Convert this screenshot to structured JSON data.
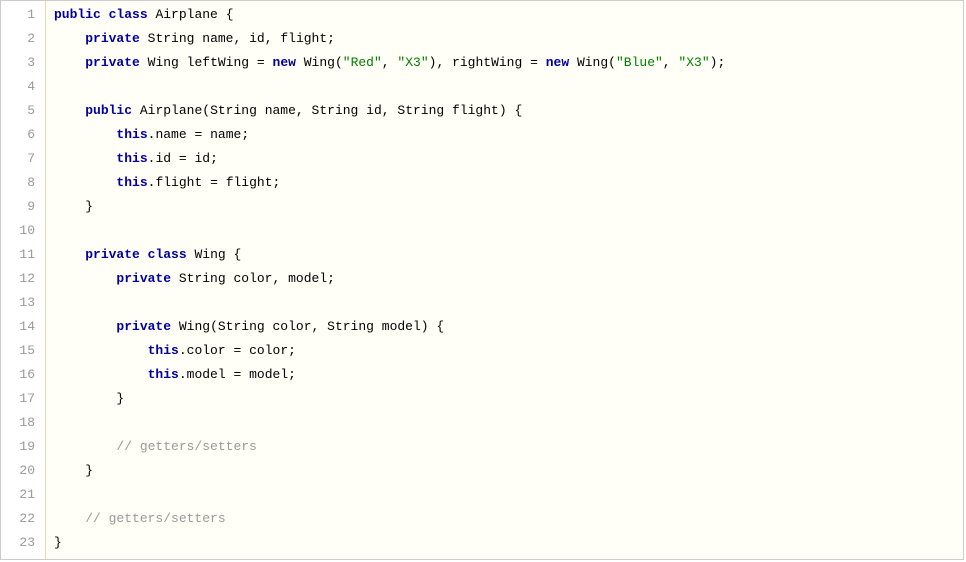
{
  "lines": [
    {
      "num": "1",
      "tokens": [
        {
          "t": "kw",
          "v": "public"
        },
        {
          "v": " "
        },
        {
          "t": "kw",
          "v": "class"
        },
        {
          "v": " "
        },
        {
          "t": "ident",
          "v": "Airplane"
        },
        {
          "v": " "
        },
        {
          "t": "punct",
          "v": "{"
        }
      ]
    },
    {
      "num": "2",
      "tokens": [
        {
          "v": "    "
        },
        {
          "t": "kw",
          "v": "private"
        },
        {
          "v": " "
        },
        {
          "t": "type",
          "v": "String"
        },
        {
          "v": " "
        },
        {
          "t": "ident",
          "v": "name"
        },
        {
          "t": "punct",
          "v": ","
        },
        {
          "v": " "
        },
        {
          "t": "ident",
          "v": "id"
        },
        {
          "t": "punct",
          "v": ","
        },
        {
          "v": " "
        },
        {
          "t": "ident",
          "v": "flight"
        },
        {
          "t": "punct",
          "v": ";"
        }
      ]
    },
    {
      "num": "3",
      "tokens": [
        {
          "v": "    "
        },
        {
          "t": "kw",
          "v": "private"
        },
        {
          "v": " "
        },
        {
          "t": "type",
          "v": "Wing"
        },
        {
          "v": " "
        },
        {
          "t": "ident",
          "v": "leftWing"
        },
        {
          "v": " "
        },
        {
          "t": "op",
          "v": "="
        },
        {
          "v": " "
        },
        {
          "t": "kw",
          "v": "new"
        },
        {
          "v": " "
        },
        {
          "t": "type",
          "v": "Wing"
        },
        {
          "t": "punct",
          "v": "("
        },
        {
          "t": "str",
          "v": "\"Red\""
        },
        {
          "t": "punct",
          "v": ","
        },
        {
          "v": " "
        },
        {
          "t": "str",
          "v": "\"X3\""
        },
        {
          "t": "punct",
          "v": ")"
        },
        {
          "t": "punct",
          "v": ","
        },
        {
          "v": " "
        },
        {
          "t": "ident",
          "v": "rightWing"
        },
        {
          "v": " "
        },
        {
          "t": "op",
          "v": "="
        },
        {
          "v": " "
        },
        {
          "t": "kw",
          "v": "new"
        },
        {
          "v": " "
        },
        {
          "t": "type",
          "v": "Wing"
        },
        {
          "t": "punct",
          "v": "("
        },
        {
          "t": "str",
          "v": "\"Blue\""
        },
        {
          "t": "punct",
          "v": ","
        },
        {
          "v": " "
        },
        {
          "t": "str",
          "v": "\"X3\""
        },
        {
          "t": "punct",
          "v": ")"
        },
        {
          "t": "punct",
          "v": ";"
        }
      ]
    },
    {
      "num": "4",
      "tokens": []
    },
    {
      "num": "5",
      "tokens": [
        {
          "v": "    "
        },
        {
          "t": "kw",
          "v": "public"
        },
        {
          "v": " "
        },
        {
          "t": "ident",
          "v": "Airplane"
        },
        {
          "t": "punct",
          "v": "("
        },
        {
          "t": "type",
          "v": "String"
        },
        {
          "v": " "
        },
        {
          "t": "ident",
          "v": "name"
        },
        {
          "t": "punct",
          "v": ","
        },
        {
          "v": " "
        },
        {
          "t": "type",
          "v": "String"
        },
        {
          "v": " "
        },
        {
          "t": "ident",
          "v": "id"
        },
        {
          "t": "punct",
          "v": ","
        },
        {
          "v": " "
        },
        {
          "t": "type",
          "v": "String"
        },
        {
          "v": " "
        },
        {
          "t": "ident",
          "v": "flight"
        },
        {
          "t": "punct",
          "v": ")"
        },
        {
          "v": " "
        },
        {
          "t": "punct",
          "v": "{"
        }
      ]
    },
    {
      "num": "6",
      "tokens": [
        {
          "v": "        "
        },
        {
          "t": "kw",
          "v": "this"
        },
        {
          "t": "punct",
          "v": "."
        },
        {
          "t": "ident",
          "v": "name"
        },
        {
          "v": " "
        },
        {
          "t": "op",
          "v": "="
        },
        {
          "v": " "
        },
        {
          "t": "ident",
          "v": "name"
        },
        {
          "t": "punct",
          "v": ";"
        }
      ]
    },
    {
      "num": "7",
      "tokens": [
        {
          "v": "        "
        },
        {
          "t": "kw",
          "v": "this"
        },
        {
          "t": "punct",
          "v": "."
        },
        {
          "t": "ident",
          "v": "id"
        },
        {
          "v": " "
        },
        {
          "t": "op",
          "v": "="
        },
        {
          "v": " "
        },
        {
          "t": "ident",
          "v": "id"
        },
        {
          "t": "punct",
          "v": ";"
        }
      ]
    },
    {
      "num": "8",
      "tokens": [
        {
          "v": "        "
        },
        {
          "t": "kw",
          "v": "this"
        },
        {
          "t": "punct",
          "v": "."
        },
        {
          "t": "ident",
          "v": "flight"
        },
        {
          "v": " "
        },
        {
          "t": "op",
          "v": "="
        },
        {
          "v": " "
        },
        {
          "t": "ident",
          "v": "flight"
        },
        {
          "t": "punct",
          "v": ";"
        }
      ]
    },
    {
      "num": "9",
      "tokens": [
        {
          "v": "    "
        },
        {
          "t": "punct",
          "v": "}"
        }
      ]
    },
    {
      "num": "10",
      "tokens": []
    },
    {
      "num": "11",
      "tokens": [
        {
          "v": "    "
        },
        {
          "t": "kw",
          "v": "private"
        },
        {
          "v": " "
        },
        {
          "t": "kw",
          "v": "class"
        },
        {
          "v": " "
        },
        {
          "t": "ident",
          "v": "Wing"
        },
        {
          "v": " "
        },
        {
          "t": "punct",
          "v": "{"
        }
      ]
    },
    {
      "num": "12",
      "tokens": [
        {
          "v": "        "
        },
        {
          "t": "kw",
          "v": "private"
        },
        {
          "v": " "
        },
        {
          "t": "type",
          "v": "String"
        },
        {
          "v": " "
        },
        {
          "t": "ident",
          "v": "color"
        },
        {
          "t": "punct",
          "v": ","
        },
        {
          "v": " "
        },
        {
          "t": "ident",
          "v": "model"
        },
        {
          "t": "punct",
          "v": ";"
        }
      ]
    },
    {
      "num": "13",
      "tokens": []
    },
    {
      "num": "14",
      "tokens": [
        {
          "v": "        "
        },
        {
          "t": "kw",
          "v": "private"
        },
        {
          "v": " "
        },
        {
          "t": "ident",
          "v": "Wing"
        },
        {
          "t": "punct",
          "v": "("
        },
        {
          "t": "type",
          "v": "String"
        },
        {
          "v": " "
        },
        {
          "t": "ident",
          "v": "color"
        },
        {
          "t": "punct",
          "v": ","
        },
        {
          "v": " "
        },
        {
          "t": "type",
          "v": "String"
        },
        {
          "v": " "
        },
        {
          "t": "ident",
          "v": "model"
        },
        {
          "t": "punct",
          "v": ")"
        },
        {
          "v": " "
        },
        {
          "t": "punct",
          "v": "{"
        }
      ]
    },
    {
      "num": "15",
      "tokens": [
        {
          "v": "            "
        },
        {
          "t": "kw",
          "v": "this"
        },
        {
          "t": "punct",
          "v": "."
        },
        {
          "t": "ident",
          "v": "color"
        },
        {
          "v": " "
        },
        {
          "t": "op",
          "v": "="
        },
        {
          "v": " "
        },
        {
          "t": "ident",
          "v": "color"
        },
        {
          "t": "punct",
          "v": ";"
        }
      ]
    },
    {
      "num": "16",
      "tokens": [
        {
          "v": "            "
        },
        {
          "t": "kw",
          "v": "this"
        },
        {
          "t": "punct",
          "v": "."
        },
        {
          "t": "ident",
          "v": "model"
        },
        {
          "v": " "
        },
        {
          "t": "op",
          "v": "="
        },
        {
          "v": " "
        },
        {
          "t": "ident",
          "v": "model"
        },
        {
          "t": "punct",
          "v": ";"
        }
      ]
    },
    {
      "num": "17",
      "tokens": [
        {
          "v": "        "
        },
        {
          "t": "punct",
          "v": "}"
        }
      ]
    },
    {
      "num": "18",
      "tokens": []
    },
    {
      "num": "19",
      "tokens": [
        {
          "v": "        "
        },
        {
          "t": "comment",
          "v": "// getters/setters"
        }
      ]
    },
    {
      "num": "20",
      "tokens": [
        {
          "v": "    "
        },
        {
          "t": "punct",
          "v": "}"
        }
      ]
    },
    {
      "num": "21",
      "tokens": []
    },
    {
      "num": "22",
      "tokens": [
        {
          "v": "    "
        },
        {
          "t": "comment",
          "v": "// getters/setters"
        }
      ]
    },
    {
      "num": "23",
      "tokens": [
        {
          "t": "punct",
          "v": "}"
        }
      ]
    }
  ]
}
